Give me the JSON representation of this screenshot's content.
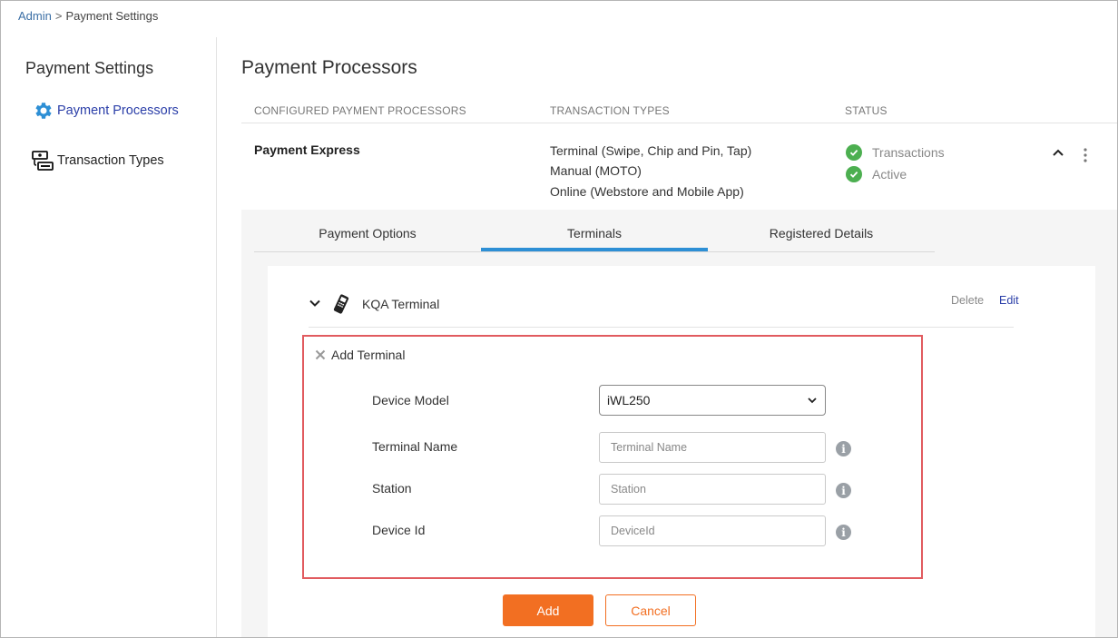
{
  "breadcrumb": {
    "root": "Admin",
    "separator": ">",
    "current": "Payment Settings"
  },
  "sidebar": {
    "title": "Payment Settings",
    "items": [
      {
        "label": "Payment Processors",
        "icon": "gear-icon",
        "active": true
      },
      {
        "label": "Transaction Types",
        "icon": "cash-register-icon",
        "active": false
      }
    ]
  },
  "main": {
    "title": "Payment Processors",
    "columns": [
      "CONFIGURED PAYMENT PROCESSORS",
      "TRANSACTION TYPES",
      "STATUS"
    ],
    "processor": {
      "name": "Payment Express",
      "transaction_types": [
        "Terminal (Swipe, Chip and Pin, Tap)",
        "Manual (MOTO)",
        "Online (Webstore and Mobile App)"
      ],
      "status": [
        "Transactions",
        "Active"
      ]
    },
    "tabs": [
      {
        "label": "Payment Options",
        "active": false
      },
      {
        "label": "Terminals",
        "active": true
      },
      {
        "label": "Registered Details",
        "active": false
      }
    ],
    "terminal": {
      "name": "KQA Terminal",
      "delete_label": "Delete",
      "edit_label": "Edit"
    },
    "add_terminal": {
      "title": "Add Terminal",
      "device_model": {
        "label": "Device Model",
        "value": "iWL250"
      },
      "terminal_name": {
        "label": "Terminal Name",
        "placeholder": "Terminal Name"
      },
      "station": {
        "label": "Station",
        "placeholder": "Station"
      },
      "device_id": {
        "label": "Device Id",
        "placeholder": "DeviceId"
      }
    },
    "buttons": {
      "add": "Add",
      "cancel": "Cancel"
    }
  },
  "colors": {
    "accent_orange": "#f26f22",
    "active_tab_blue": "#2d8fd5",
    "status_green": "#4caf50",
    "highlight_red": "#e15b5f",
    "link_blue": "#2a3ea8"
  }
}
